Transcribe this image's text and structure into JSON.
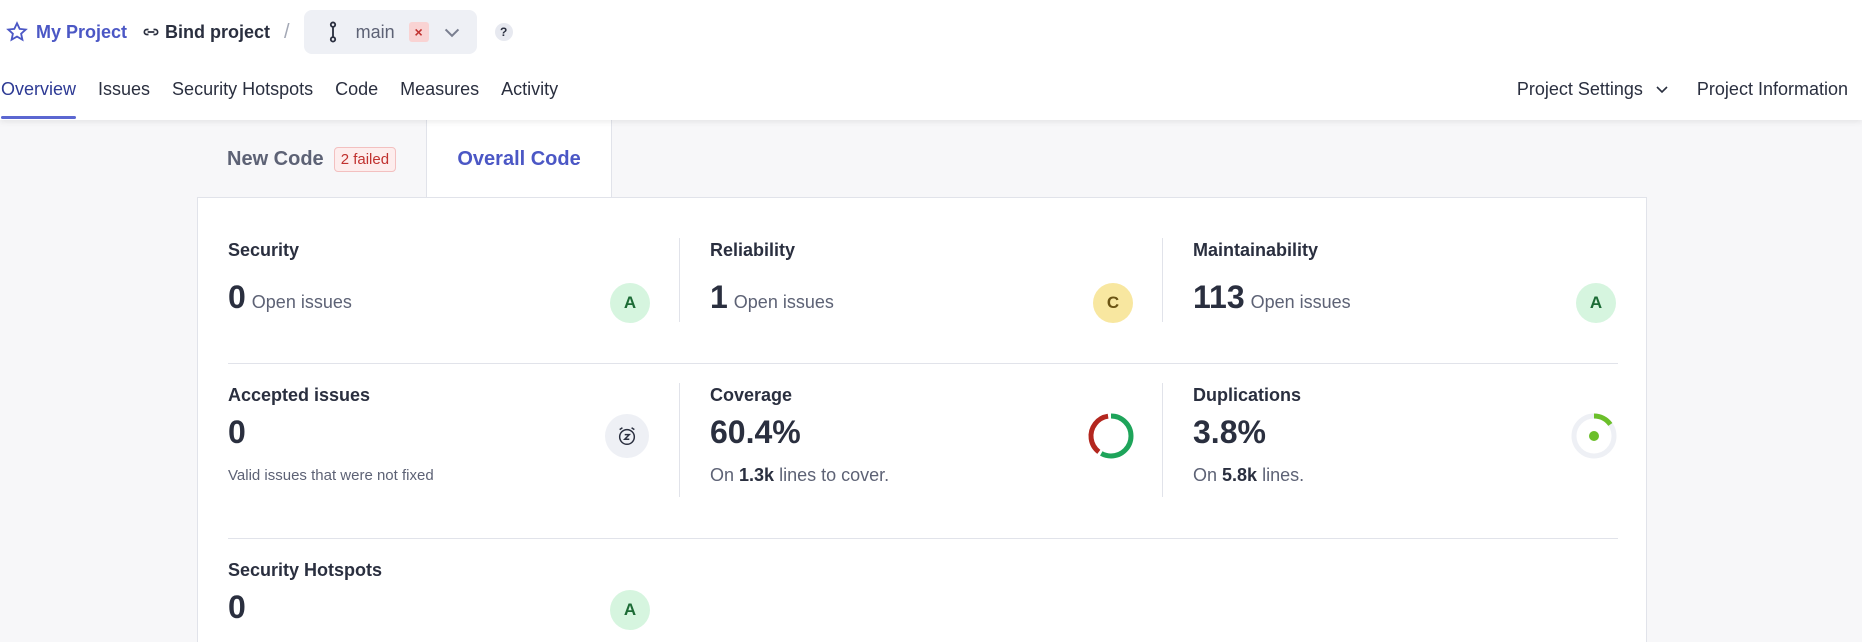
{
  "header": {
    "project_name": "My Project",
    "bind_label": "Bind project",
    "separator": "/",
    "branch": "main",
    "branch_fail_mark": "×",
    "help_label": "?"
  },
  "nav": {
    "items": [
      "Overview",
      "Issues",
      "Security Hotspots",
      "Code",
      "Measures",
      "Activity"
    ],
    "active_index": 0,
    "settings_label": "Project Settings",
    "info_label": "Project Information"
  },
  "tabs": {
    "new_code": "New Code",
    "new_code_badge": "2 failed",
    "overall_code": "Overall Code"
  },
  "metrics": {
    "security": {
      "title": "Security",
      "value": "0",
      "label": "Open issues",
      "grade": "A"
    },
    "reliability": {
      "title": "Reliability",
      "value": "1",
      "label": "Open issues",
      "grade": "C"
    },
    "maintainability": {
      "title": "Maintainability",
      "value": "113",
      "label": "Open issues",
      "grade": "A"
    },
    "accepted": {
      "title": "Accepted issues",
      "value": "0",
      "note": "Valid issues that were not fixed"
    },
    "coverage": {
      "title": "Coverage",
      "value": "60.4%",
      "lines_prefix": "On",
      "lines_value": "1.3k",
      "lines_suffix": "lines to cover.",
      "percent": 60.4
    },
    "duplications": {
      "title": "Duplications",
      "value": "3.8%",
      "lines_prefix": "On",
      "lines_value": "5.8k",
      "lines_suffix": "lines.",
      "percent": 3.8
    },
    "hotspots": {
      "title": "Security Hotspots",
      "value": "0",
      "grade": "A"
    }
  },
  "colors": {
    "accent": "#4b57c5",
    "grade_a_bg": "#d6f5df",
    "grade_c_bg": "#f8e7a0",
    "coverage_good": "#1ea45a",
    "coverage_bad": "#b3261e",
    "duplication": "#6bbf2a",
    "failed": "#c0312f"
  }
}
